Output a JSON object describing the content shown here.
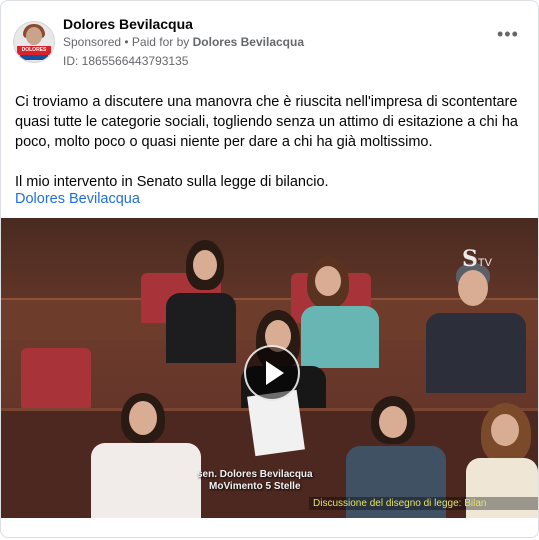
{
  "post": {
    "author": "Dolores Bevilacqua",
    "sponsored": "Sponsored",
    "paid_for_prefix": " • Paid for by ",
    "paid_for_name": "Dolores Bevilacqua",
    "ad_id": "ID: 1865566443793135",
    "more_label": "•••",
    "text_para1": "Ci troviamo a discutere una manovra che è riuscita nell'impresa di scontentare quasi tutte le categorie sociali, togliendo senza un attimo di esitazione a chi ha poco, molto poco o quasi niente per dare a chi ha già moltissimo.",
    "text_para2": "Il mio intervento in Senato sulla legge di bilancio.",
    "link_text": "Dolores Bevilacqua"
  },
  "avatar": {
    "band_text": "DOLORES BEVILACQUA"
  },
  "video": {
    "logo": "S",
    "logo_suffix": "TV",
    "caption_line1": "sen. Dolores Bevilacqua",
    "caption_line2": "MoVimento 5 Stelle",
    "caption_ticker": "Discussione del disegno di legge: Bilan"
  },
  "colors": {
    "link": "#216fdb",
    "ticker": "#e3e36a"
  }
}
